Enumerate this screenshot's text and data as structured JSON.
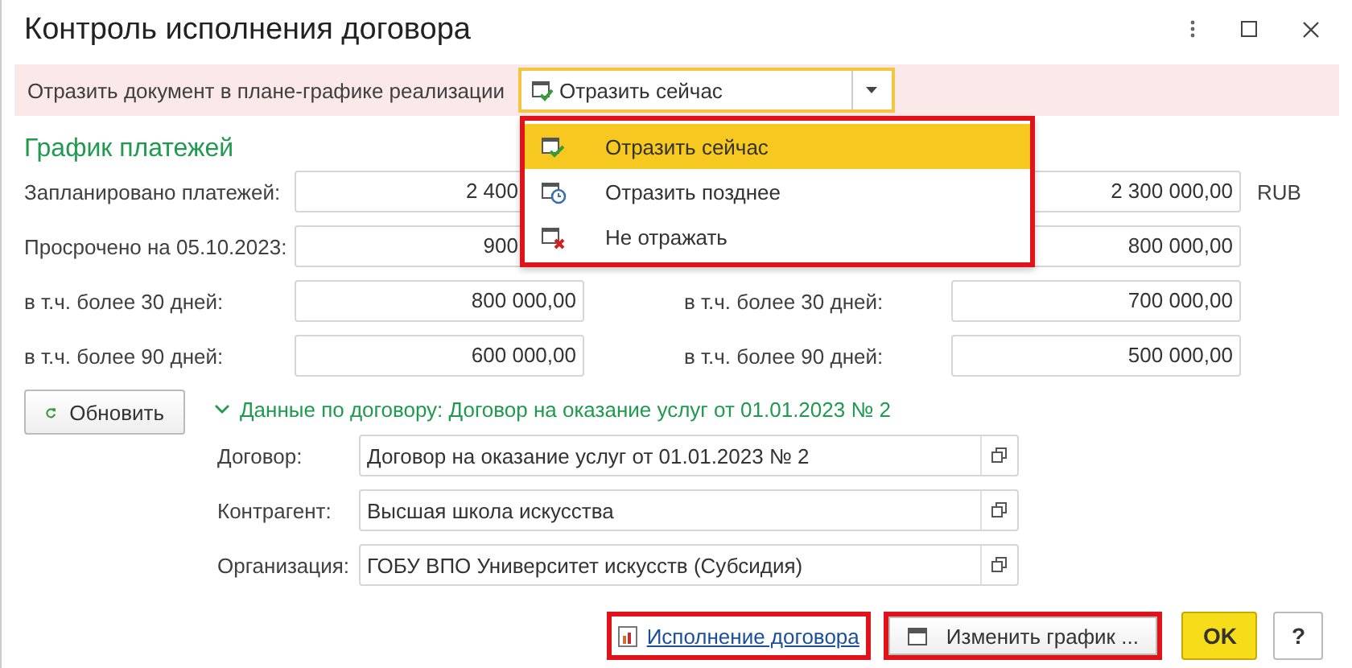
{
  "window": {
    "title": "Контроль исполнения договора"
  },
  "reflect_bar": {
    "label": "Отразить документ в плане-графике реализации",
    "select": {
      "value": "Отразить сейчас"
    }
  },
  "dropdown": {
    "highlighted": true,
    "items": [
      {
        "label": "Отразить сейчас",
        "kind": "now",
        "selected": true
      },
      {
        "label": "Отразить позднее",
        "kind": "later",
        "selected": false
      },
      {
        "label": "Не отражать",
        "kind": "none",
        "selected": false
      }
    ]
  },
  "schedule": {
    "title": "График платежей",
    "rows": [
      {
        "label": "Запланировано платежей:",
        "value": "2 400",
        "value_partly_hidden": true,
        "right_value": "2 300 000,00",
        "currency": "RUB"
      },
      {
        "label": "Просрочено на 05.10.2023:",
        "value": "900",
        "value_partly_hidden": true,
        "right_value": "800 000,00"
      },
      {
        "label": "в т.ч. более 30 дней:",
        "value": "800 000,00",
        "value_partly_hidden": false,
        "right_label": "в т.ч. более 30 дней:",
        "right_value": "700 000,00"
      },
      {
        "label": "в т.ч. более 90 дней:",
        "value": "600 000,00",
        "value_partly_hidden": false,
        "right_label": "в т.ч. более 90 дней:",
        "right_value": "500 000,00"
      }
    ]
  },
  "refresh_button": {
    "label": "Обновить"
  },
  "contract": {
    "title": "Данные по договору: Договор на оказание услуг от 01.01.2023 № 2",
    "expanded": true,
    "fields": [
      {
        "label": "Договор:",
        "value": "Договор на оказание услуг от 01.01.2023 № 2"
      },
      {
        "label": "Контрагент:",
        "value": "Высшая школа искусства"
      },
      {
        "label": "Организация:",
        "value": "ГОБУ ВПО Университет искусств (Субсидия)"
      }
    ]
  },
  "buttons": [
    {
      "kind": "link",
      "label": "Исполнение договора",
      "highlighted": true
    },
    {
      "kind": "button",
      "label": "Изменить график ...",
      "highlighted": true
    },
    {
      "kind": "default",
      "label": "OK",
      "highlighted": false
    },
    {
      "kind": "help",
      "label": "?",
      "highlighted": false
    }
  ]
}
